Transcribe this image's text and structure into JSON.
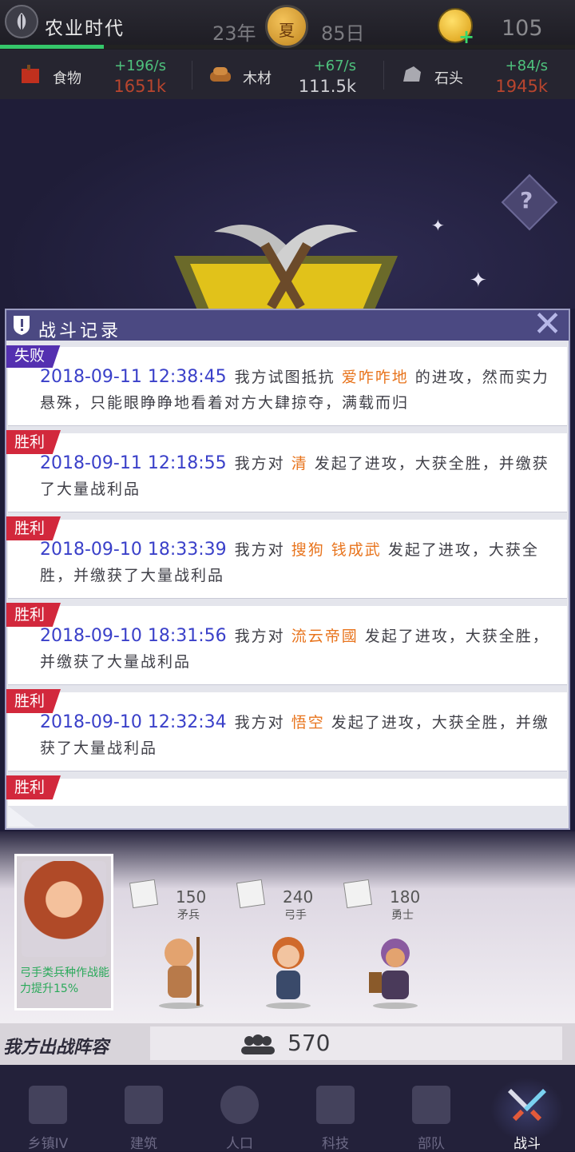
{
  "top": {
    "era_name": "农业时代",
    "year": "23年",
    "season": "夏",
    "day": "85日",
    "gold": "105",
    "era_progress_pct": 18
  },
  "resources": [
    {
      "name": "食物",
      "rate": "+196/s",
      "total": "1651k",
      "total_color": "#b8452e"
    },
    {
      "name": "木材",
      "rate": "+67/s",
      "total": "111.5k",
      "total_color": "#cfcfd4"
    },
    {
      "name": "石头",
      "rate": "+84/s",
      "total": "1945k",
      "total_color": "#b8452e"
    }
  ],
  "dialog": {
    "title": "战斗记录",
    "entries": [
      {
        "result": "失败",
        "type": "lose",
        "time": "2018-09-11 12:38:45",
        "pre": "我方试图抵抗",
        "opponent": "爱咋咋地",
        "post": "的进攻，然而实力悬殊，只能眼睁睁地看着对方大肆掠夺，满载而归"
      },
      {
        "result": "胜利",
        "type": "win",
        "time": "2018-09-11 12:18:55",
        "pre": "我方对",
        "opponent": "清",
        "post": "发起了进攻，大获全胜，并缴获了大量战利品"
      },
      {
        "result": "胜利",
        "type": "win",
        "time": "2018-09-10 18:33:39",
        "pre": "我方对",
        "opponent": "搜狗 钱成武",
        "post": "发起了进攻，大获全胜，并缴获了大量战利品"
      },
      {
        "result": "胜利",
        "type": "win",
        "time": "2018-09-10 18:31:56",
        "pre": "我方对",
        "opponent": "流云帝國",
        "post": "发起了进攻，大获全胜，并缴获了大量战利品"
      },
      {
        "result": "胜利",
        "type": "win",
        "time": "2018-09-10 12:32:34",
        "pre": "我方对",
        "opponent": "悟空",
        "post": "发起了进攻，大获全胜，并缴获了大量战利品"
      },
      {
        "result": "胜利",
        "type": "win",
        "time": "",
        "pre": "",
        "opponent": "",
        "post": ""
      }
    ]
  },
  "lineup": {
    "general_desc": "弓手类兵种作战能力提升15%",
    "units": [
      {
        "count": "150",
        "name": "矛兵"
      },
      {
        "count": "240",
        "name": "弓手"
      },
      {
        "count": "180",
        "name": "勇士"
      }
    ],
    "summary_label": "我方出战阵容",
    "power": "570"
  },
  "nav": [
    {
      "label": "乡镇IV",
      "icon": "town-icon"
    },
    {
      "label": "建筑",
      "icon": "building-icon"
    },
    {
      "label": "人口",
      "icon": "population-icon"
    },
    {
      "label": "科技",
      "icon": "tech-book-icon"
    },
    {
      "label": "部队",
      "icon": "army-icon"
    },
    {
      "label": "战斗",
      "icon": "battle-swords-icon",
      "active": true
    }
  ]
}
